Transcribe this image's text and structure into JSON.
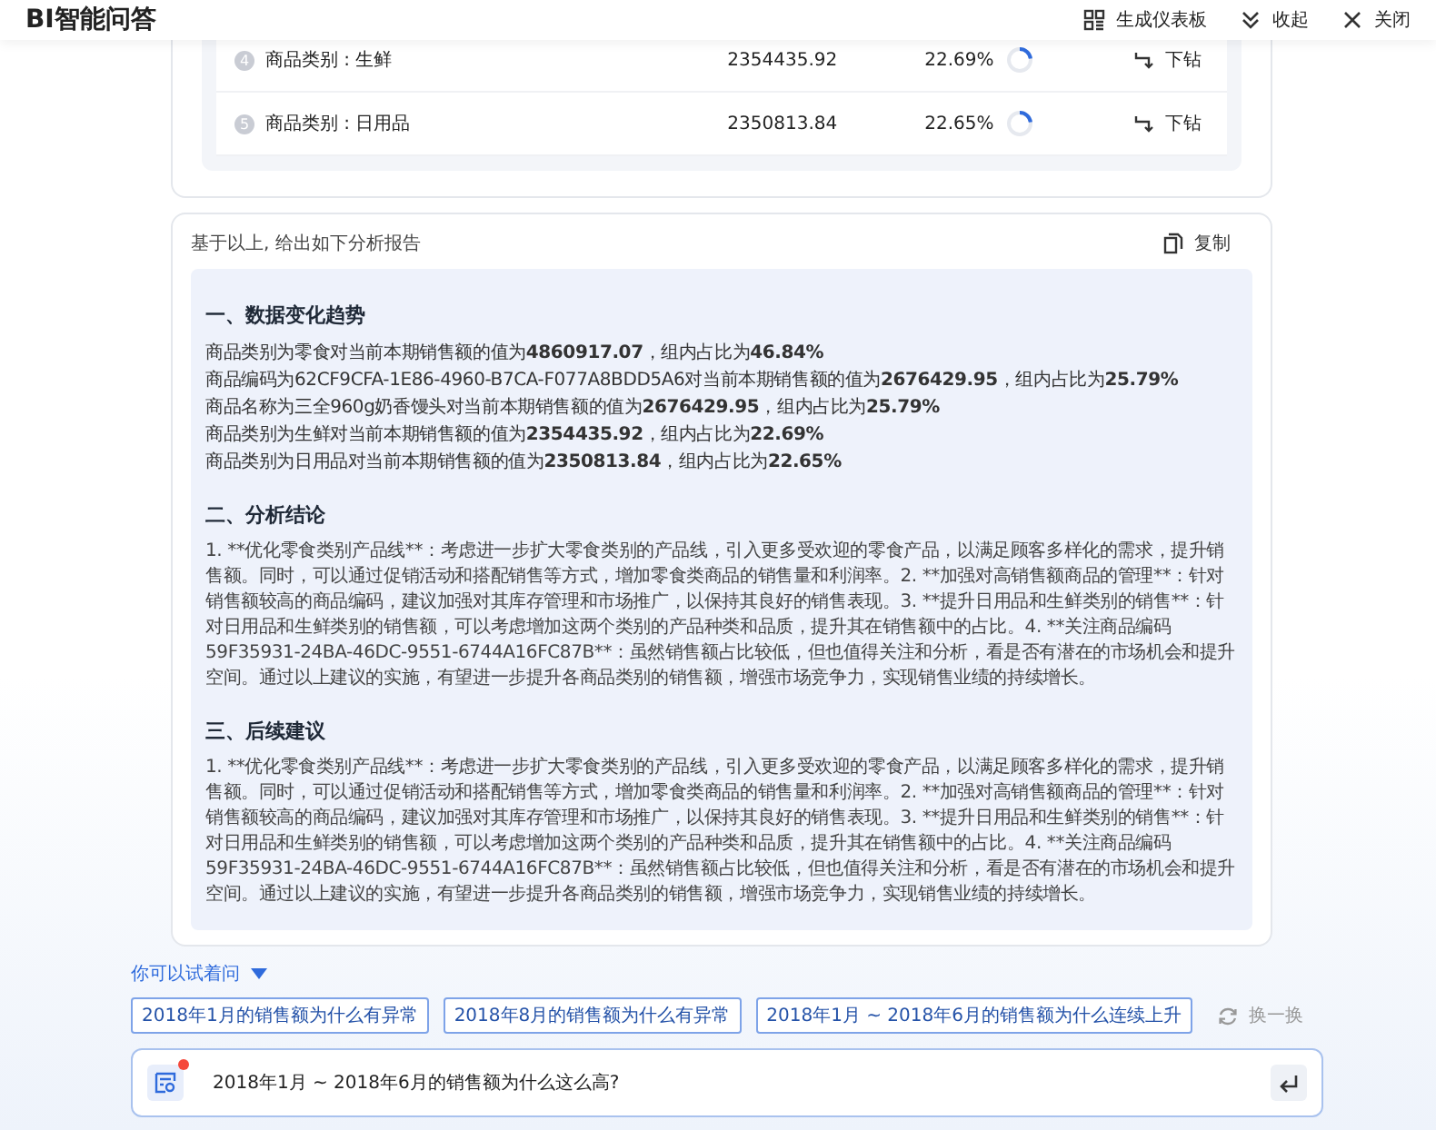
{
  "header": {
    "title": "BI智能问答",
    "actions": [
      {
        "kind": "dashboard",
        "label": "生成仪表板"
      },
      {
        "kind": "collapse",
        "label": "收起"
      },
      {
        "kind": "close",
        "label": "关闭"
      }
    ]
  },
  "table": {
    "rows": [
      {
        "rank": "4",
        "name": "商品类别 : 生鲜",
        "value": "2354435.92",
        "share": "22.69%",
        "level": 0.2269,
        "action": "下钻"
      },
      {
        "rank": "5",
        "name": "商品类别 : 日用品",
        "value": "2350813.84",
        "share": "22.65%",
        "level": 0.2265,
        "action": "下钻"
      }
    ]
  },
  "report": {
    "intro": "基于以上, 给出如下分析报告",
    "copy": "复制",
    "sections": [
      {
        "heading": "一、数据变化趋势",
        "kind": "lines",
        "lines": [
          "商品类别为零食对当前本期销售额的值为**4860917.07**，组内占比为**46.84%**",
          "商品编码为62CF9CFA-1E86-4960-B7CA-F077A8BDD5A6对当前本期销售额的值为**2676429.95**，组内占比为**25.79%**",
          "商品名称为三全960g奶香馒头对当前本期销售额的值为**2676429.95**，组内占比为**25.79%**",
          "商品类别为生鲜对当前本期销售额的值为**2354435.92**，组内占比为**22.69%**",
          "商品类别为日用品对当前本期销售额的值为**2350813.84**，组内占比为**22.65%**"
        ]
      },
      {
        "heading": "二、分析结论",
        "kind": "paragraph",
        "text": "1. **优化零食类别产品线**：考虑进一步扩大零食类别的产品线，引入更多受欢迎的零食产品，以满足顾客多样化的需求，提升销售额。同时，可以通过促销活动和搭配销售等方式，增加零食类商品的销售量和利润率。2. **加强对高销售额商品的管理**：针对销售额较高的商品编码，建议加强对其库存管理和市场推广，以保持其良好的销售表现。3. **提升日用品和生鲜类别的销售**：针对日用品和生鲜类别的销售额，可以考虑增加这两个类别的产品种类和品质，提升其在销售额中的占比。4. **关注商品编码59F35931-24BA-46DC-9551-6744A16FC87B**：虽然销售额占比较低，但也值得关注和分析，看是否有潜在的市场机会和提升空间。通过以上建议的实施，有望进一步提升各商品类别的销售额，增强市场竞争力，实现销售业绩的持续增长。"
      },
      {
        "heading": "三、后续建议",
        "kind": "paragraph",
        "text": "1. **优化零食类别产品线**：考虑进一步扩大零食类别的产品线，引入更多受欢迎的零食产品，以满足顾客多样化的需求，提升销售额。同时，可以通过促销活动和搭配销售等方式，增加零食类商品的销售量和利润率。2. **加强对高销售额商品的管理**：针对销售额较高的商品编码，建议加强对其库存管理和市场推广，以保持其良好的销售表现。3. **提升日用品和生鲜类别的销售**：针对日用品和生鲜类别的销售额，可以考虑增加这两个类别的产品种类和品质，提升其在销售额中的占比。4. **关注商品编码59F35931-24BA-46DC-9551-6744A16FC87B**：虽然销售额占比较低，但也值得关注和分析，看是否有潜在的市场机会和提升空间。通过以上建议的实施，有望进一步提升各商品类别的销售额，增强市场竞争力，实现销售业绩的持续增长。"
      }
    ]
  },
  "suggestions": {
    "title": "你可以试着问",
    "expanded": true,
    "items": [
      "2018年1月的销售额为什么有异常",
      "2018年8月的销售额为什么有异常",
      "2018年1月 ~ 2018年6月的销售额为什么连续上升"
    ],
    "refresh": "换一换"
  },
  "input": {
    "value": "2018年1月 ~ 2018年6月的销售额为什么这么高?"
  }
}
